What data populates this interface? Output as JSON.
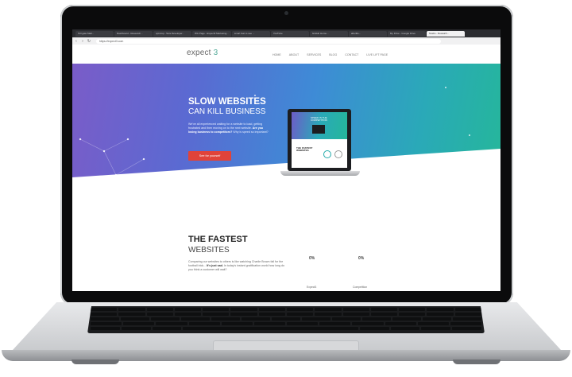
{
  "browser": {
    "tabs": [
      {
        "label": "Toll gate Matt...",
        "active": false
      },
      {
        "label": "Dashboard - Research...",
        "active": false
      },
      {
        "label": "optmisp - Siva Developer...",
        "active": false
      },
      {
        "label": "Wix Page - Expect3 Marketing...",
        "active": false
      },
      {
        "label": "smart fast to see ...",
        "active": false
      },
      {
        "label": "YouTube",
        "active": false
      },
      {
        "label": "GitHub Home...",
        "active": false
      },
      {
        "label": "afterlife...",
        "active": false
      },
      {
        "label": "My Drive - Google Drive",
        "active": false
      },
      {
        "label": "Studio - Rewatch...",
        "active": true
      }
    ],
    "url": "https://expect3.com"
  },
  "site": {
    "logo_text": "expect",
    "logo_mark": "3",
    "nav": [
      "HOME",
      "ABOUT",
      "SERVICES",
      "BLOG",
      "CONTACT",
      "LIVE LIFT PAGE"
    ]
  },
  "hero": {
    "title_line1": "SLOW WEBSITES",
    "title_line2": "CAN KILL BUSINESS",
    "copy": "We've all experienced waiting for a website to load, getting frustrated and then moving on to the next website.",
    "copy_bold": "Are you losing business to competitors?",
    "copy_tail": "Why is speed so important?",
    "cta": "See for yourself"
  },
  "mini_screen": {
    "headline": "SPEED IS THE COMPETITION",
    "sub_title": "THE FASTEST WEBSITES"
  },
  "section2": {
    "title": "THE FASTEST",
    "subtitle": "WEBSITES",
    "copy": "Comparing our websites to others is like watching Charlie Brown fall for the football trick...",
    "copy_bold": "It's just sad.",
    "copy_tail": "In today's instant gratification world how long do you think a customer will wait?",
    "stats": [
      {
        "value": "0%",
        "label": "Expect3"
      },
      {
        "value": "0%",
        "label": "Competition"
      }
    ]
  }
}
